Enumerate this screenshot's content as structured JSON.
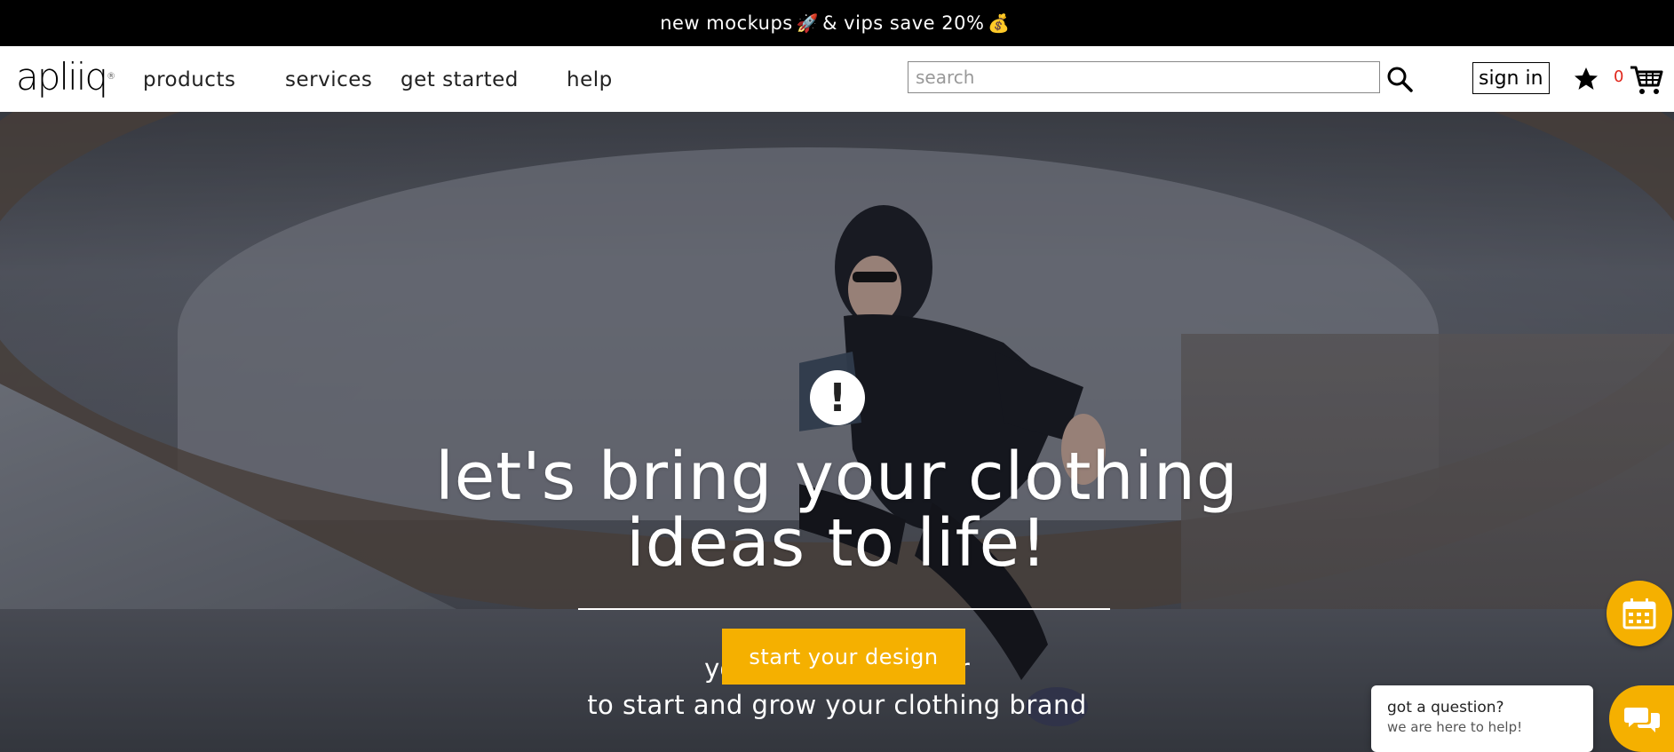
{
  "promo": {
    "text_before": "new mockups",
    "text_mid": "& vips save 20%",
    "rocket_icon": "rocket-icon",
    "moneybag_icon": "money-bag-icon"
  },
  "nav": {
    "logo": "apliiq",
    "links": [
      "products",
      "services",
      "get started",
      "help"
    ],
    "search_placeholder": "search",
    "signin": "sign in",
    "cart_count": "0"
  },
  "hero": {
    "badge": "!",
    "headline_line1": "let's bring your clothing",
    "headline_line2": "ideas to life!",
    "cta": "start your design",
    "sub_line1_left": "yo",
    "sub_line1_right": "er",
    "sub_line2": "to start and grow your clothing brand"
  },
  "chat": {
    "title": "got a question?",
    "subtitle": "we are here to help!"
  },
  "colors": {
    "accent": "#f5b000",
    "cart_count": "#e0261b",
    "promo_bg": "#000000"
  }
}
